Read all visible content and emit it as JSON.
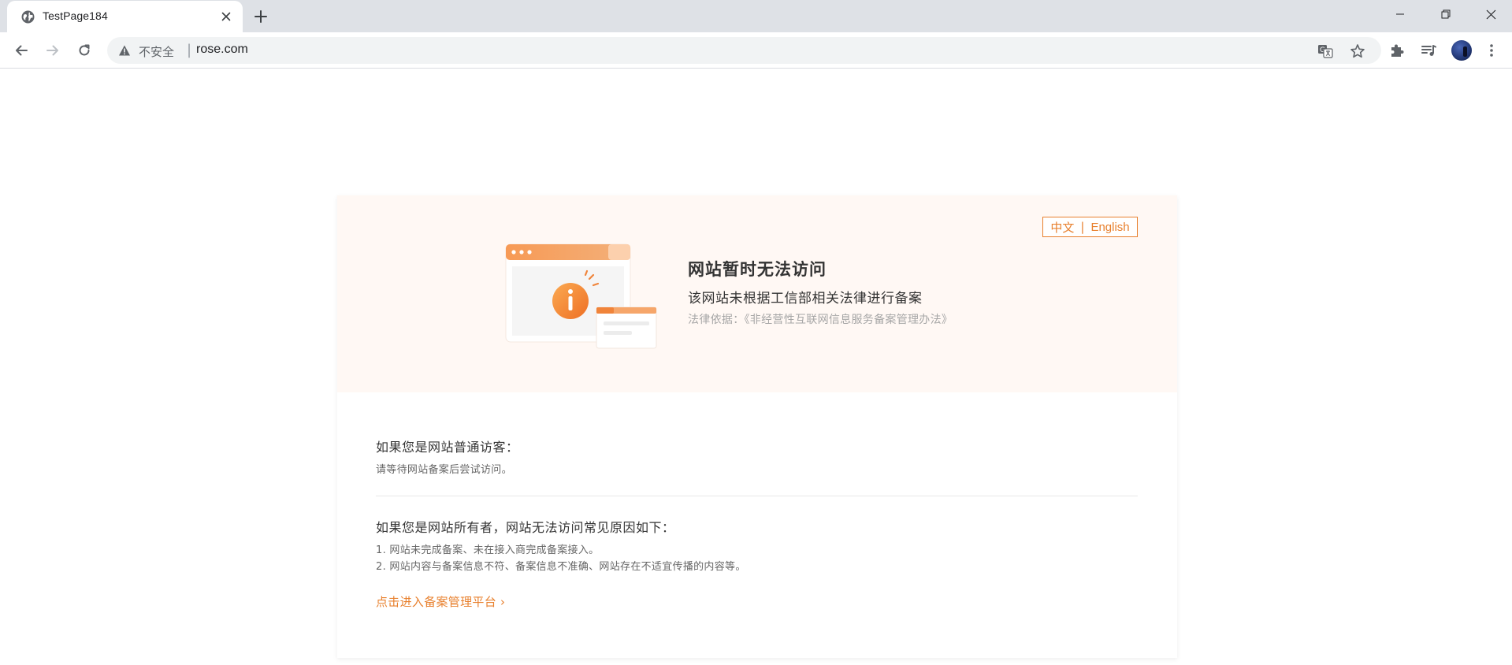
{
  "browser": {
    "tab": {
      "title": "TestPage184"
    },
    "omnibox": {
      "security_label": "不安全",
      "separator": "|",
      "url": "rose.com"
    },
    "icons": {
      "tab_favicon": "globe-icon",
      "tab_close": "close-icon",
      "new_tab": "plus-icon",
      "minimize": "minimize-icon",
      "restore": "restore-icon",
      "window_close": "close-icon",
      "back": "arrow-left-icon",
      "forward": "arrow-right-icon",
      "reload": "reload-icon",
      "warning": "warning-triangle-icon",
      "translate": "translate-icon",
      "bookmark": "star-icon",
      "extensions": "puzzle-icon",
      "media": "media-playlist-icon",
      "menu": "more-vertical-icon"
    }
  },
  "page": {
    "colors": {
      "accent": "#e8802e",
      "hero_background": "#fff8f4",
      "title_text": "#333333",
      "muted_text": "#a6a6a6"
    },
    "language_switch": {
      "zh": "中文",
      "divider": "|",
      "en": "English"
    },
    "hero": {
      "illustration_icon": "info-icon",
      "title": "网站暂时无法访问",
      "subtitle": "该网站未根据工信部相关法律进行备案",
      "law_basis": "法律依据：《非经营性互联网信息服务备案管理办法》"
    },
    "visitor": {
      "heading": "如果您是网站普通访客：",
      "text": "请等待网站备案后尝试访问。"
    },
    "owner": {
      "heading": "如果您是网站所有者，网站无法访问常见原因如下：",
      "reasons": [
        "1. 网站未完成备案、未在接入商完成备案接入。",
        "2. 网站内容与备案信息不符、备案信息不准确、网站存在不适宜传播的内容等。"
      ]
    },
    "link": {
      "label": "点击进入备案管理平台",
      "chevron": "›"
    }
  }
}
